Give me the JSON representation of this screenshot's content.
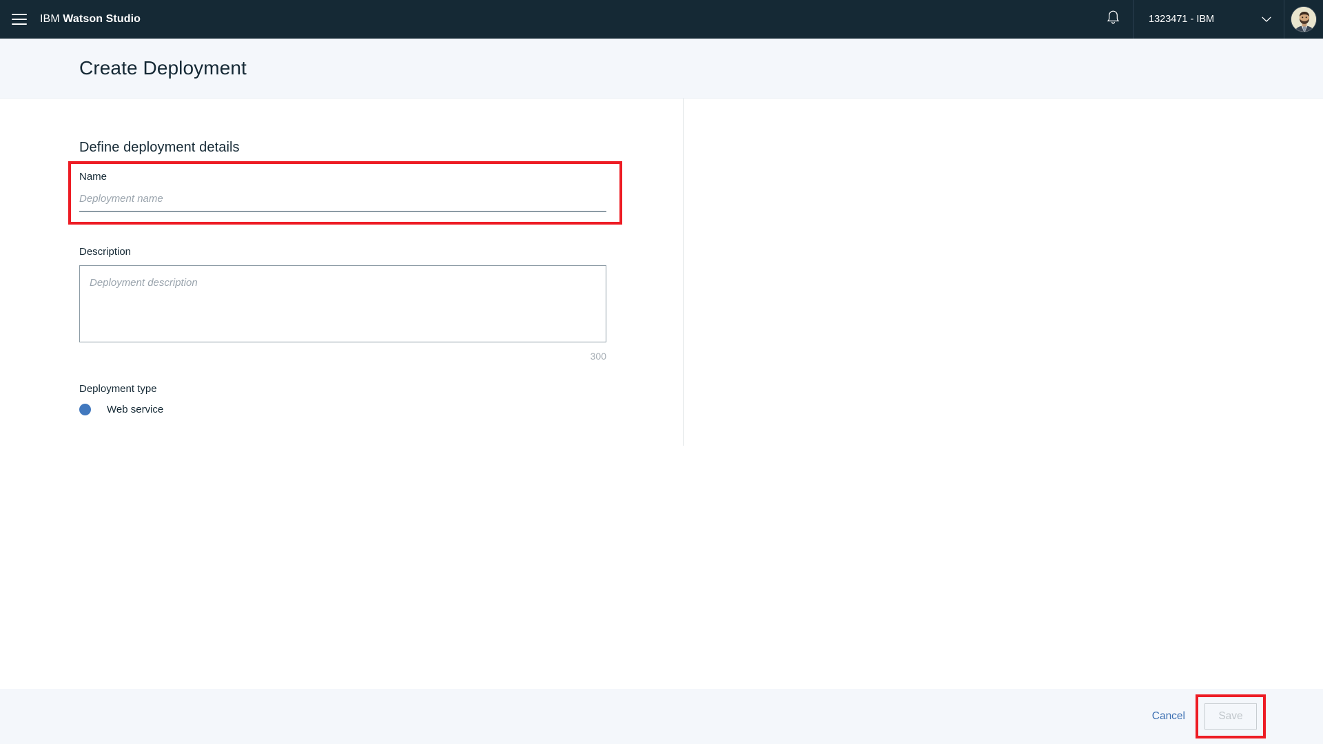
{
  "topbar": {
    "menu_icon": "hamburger-menu-icon",
    "brand_prefix": "IBM",
    "brand_product": "Watson Studio",
    "notification_icon": "bell-icon",
    "account_label": "1323471 - IBM",
    "account_caret_icon": "chevron-down-icon",
    "avatar_icon": "user-avatar-photo",
    "background_color": "#152935"
  },
  "page": {
    "title": "Create Deployment",
    "background_color": "#f4f7fb"
  },
  "form": {
    "section_heading": "Define deployment details",
    "name": {
      "label": "Name",
      "value": "",
      "placeholder": "Deployment name"
    },
    "description": {
      "label": "Description",
      "value": "",
      "placeholder": "Deployment description",
      "char_counter": "300"
    },
    "deployment_type": {
      "label": "Deployment type",
      "options": [
        {
          "label": "Web service",
          "selected": true
        }
      ],
      "selected_color": "#4178be"
    }
  },
  "footer": {
    "cancel_label": "Cancel",
    "save_label": "Save",
    "save_disabled": true,
    "cancel_color": "#3d70b2"
  },
  "annotations": {
    "highlight_color": "#ed1c24",
    "boxes": [
      {
        "target": "name-field-group"
      },
      {
        "target": "save-button"
      }
    ]
  }
}
